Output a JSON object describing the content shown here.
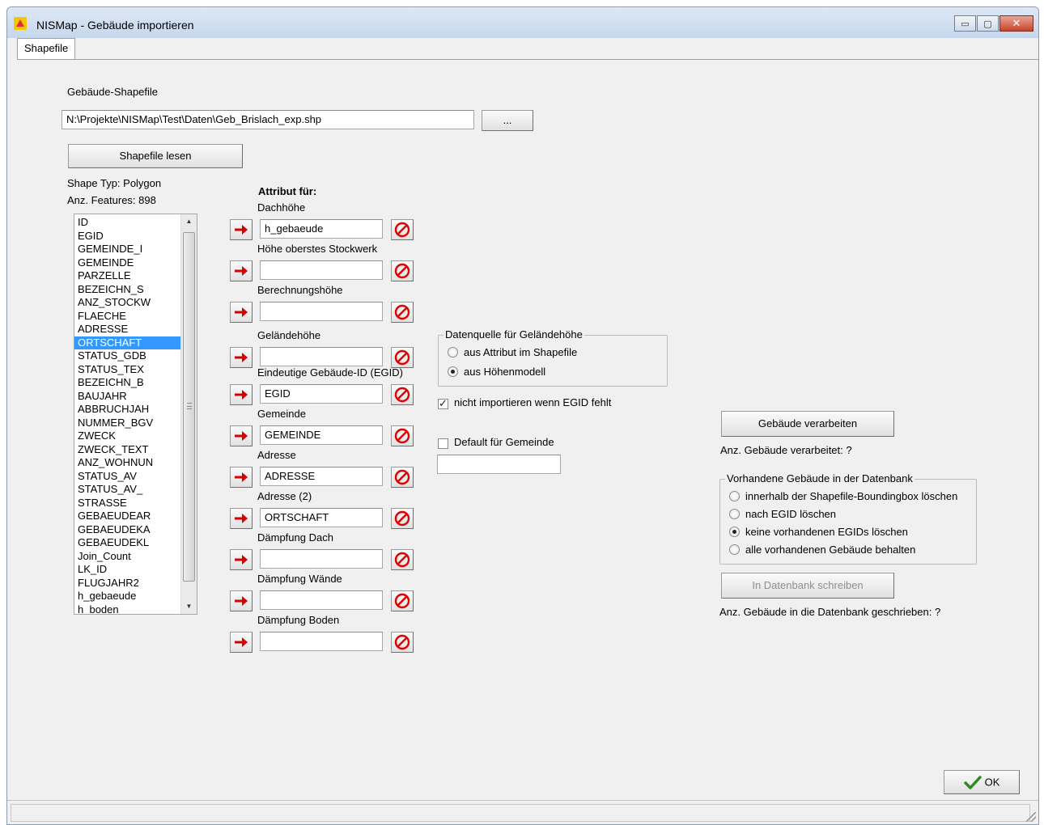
{
  "window": {
    "title": "NISMap - Gebäude importieren",
    "minimize": "▭",
    "maximize": "▢",
    "close": "✕"
  },
  "tab": {
    "label": "Shapefile"
  },
  "shapefile": {
    "label": "Gebäude-Shapefile",
    "path": "N:\\Projekte\\NISMap\\Test\\Daten\\Geb_Brislach_exp.shp",
    "browse_label": "...",
    "read_button": "Shapefile lesen",
    "shape_type": "Shape Typ: Polygon",
    "feature_count": "Anz. Features: 898"
  },
  "fields": [
    "ID",
    "EGID",
    "GEMEINDE_I",
    "GEMEINDE",
    "PARZELLE",
    "BEZEICHN_S",
    "ANZ_STOCKW",
    "FLAECHE",
    "ADRESSE",
    "ORTSCHAFT",
    "STATUS_GDB",
    "STATUS_TEX",
    "BEZEICHN_B",
    "BAUJAHR",
    "ABBRUCHJAH",
    "NUMMER_BGV",
    "ZWECK",
    "ZWECK_TEXT",
    "ANZ_WOHNUN",
    "STATUS_AV",
    "STATUS_AV_",
    "STRASSE",
    "GEBAEUDEAR",
    "GEBAEUDEKA",
    "GEBAEUDEKL",
    "Join_Count",
    "LK_ID",
    "FLUGJAHR2",
    "h_gebaeude",
    "h_boden"
  ],
  "selected_field": "ORTSCHAFT",
  "attributes": {
    "heading": "Attribut für:",
    "rows": [
      {
        "label": "Dachhöhe",
        "value": "h_gebaeude"
      },
      {
        "label": "Höhe oberstes Stockwerk",
        "value": ""
      },
      {
        "label": "Berechnungshöhe",
        "value": ""
      },
      {
        "label": "Geländehöhe",
        "value": ""
      },
      {
        "label": "Eindeutige Gebäude-ID (EGID)",
        "value": "EGID"
      },
      {
        "label": "Gemeinde",
        "value": "GEMEINDE"
      },
      {
        "label": "Adresse",
        "value": "ADRESSE"
      },
      {
        "label": "Adresse (2)",
        "value": "ORTSCHAFT"
      },
      {
        "label": "Dämpfung Dach",
        "value": ""
      },
      {
        "label": "Dämpfung Wände",
        "value": ""
      },
      {
        "label": "Dämpfung Boden",
        "value": ""
      }
    ]
  },
  "terrain_source": {
    "legend": "Datenquelle für Geländehöhe",
    "options": [
      "aus Attribut im Shapefile",
      "aus Höhenmodell"
    ],
    "selected": 1
  },
  "egid_option": {
    "label": "nicht importieren wenn EGID fehlt",
    "checked": true
  },
  "default_gemeinde": {
    "label": "Default für Gemeinde",
    "checked": false,
    "value": ""
  },
  "process": {
    "button": "Gebäude verarbeiten",
    "status": "Anz. Gebäude verarbeitet: ?"
  },
  "existing": {
    "legend": "Vorhandene Gebäude in der Datenbank",
    "options": [
      "innerhalb der Shapefile-Boundingbox löschen",
      "nach EGID löschen",
      "keine vorhandenen EGIDs löschen",
      "alle vorhandenen Gebäude behalten"
    ],
    "selected": 2
  },
  "write": {
    "button": "In Datenbank schreiben",
    "status": "Anz. Gebäude in die Datenbank geschrieben: ?"
  },
  "ok_button": "OK",
  "colors": {
    "selection": "#3399ff",
    "arrow": "#d40000",
    "clear": "#e00000",
    "ok_check": "#2e8b1e"
  }
}
